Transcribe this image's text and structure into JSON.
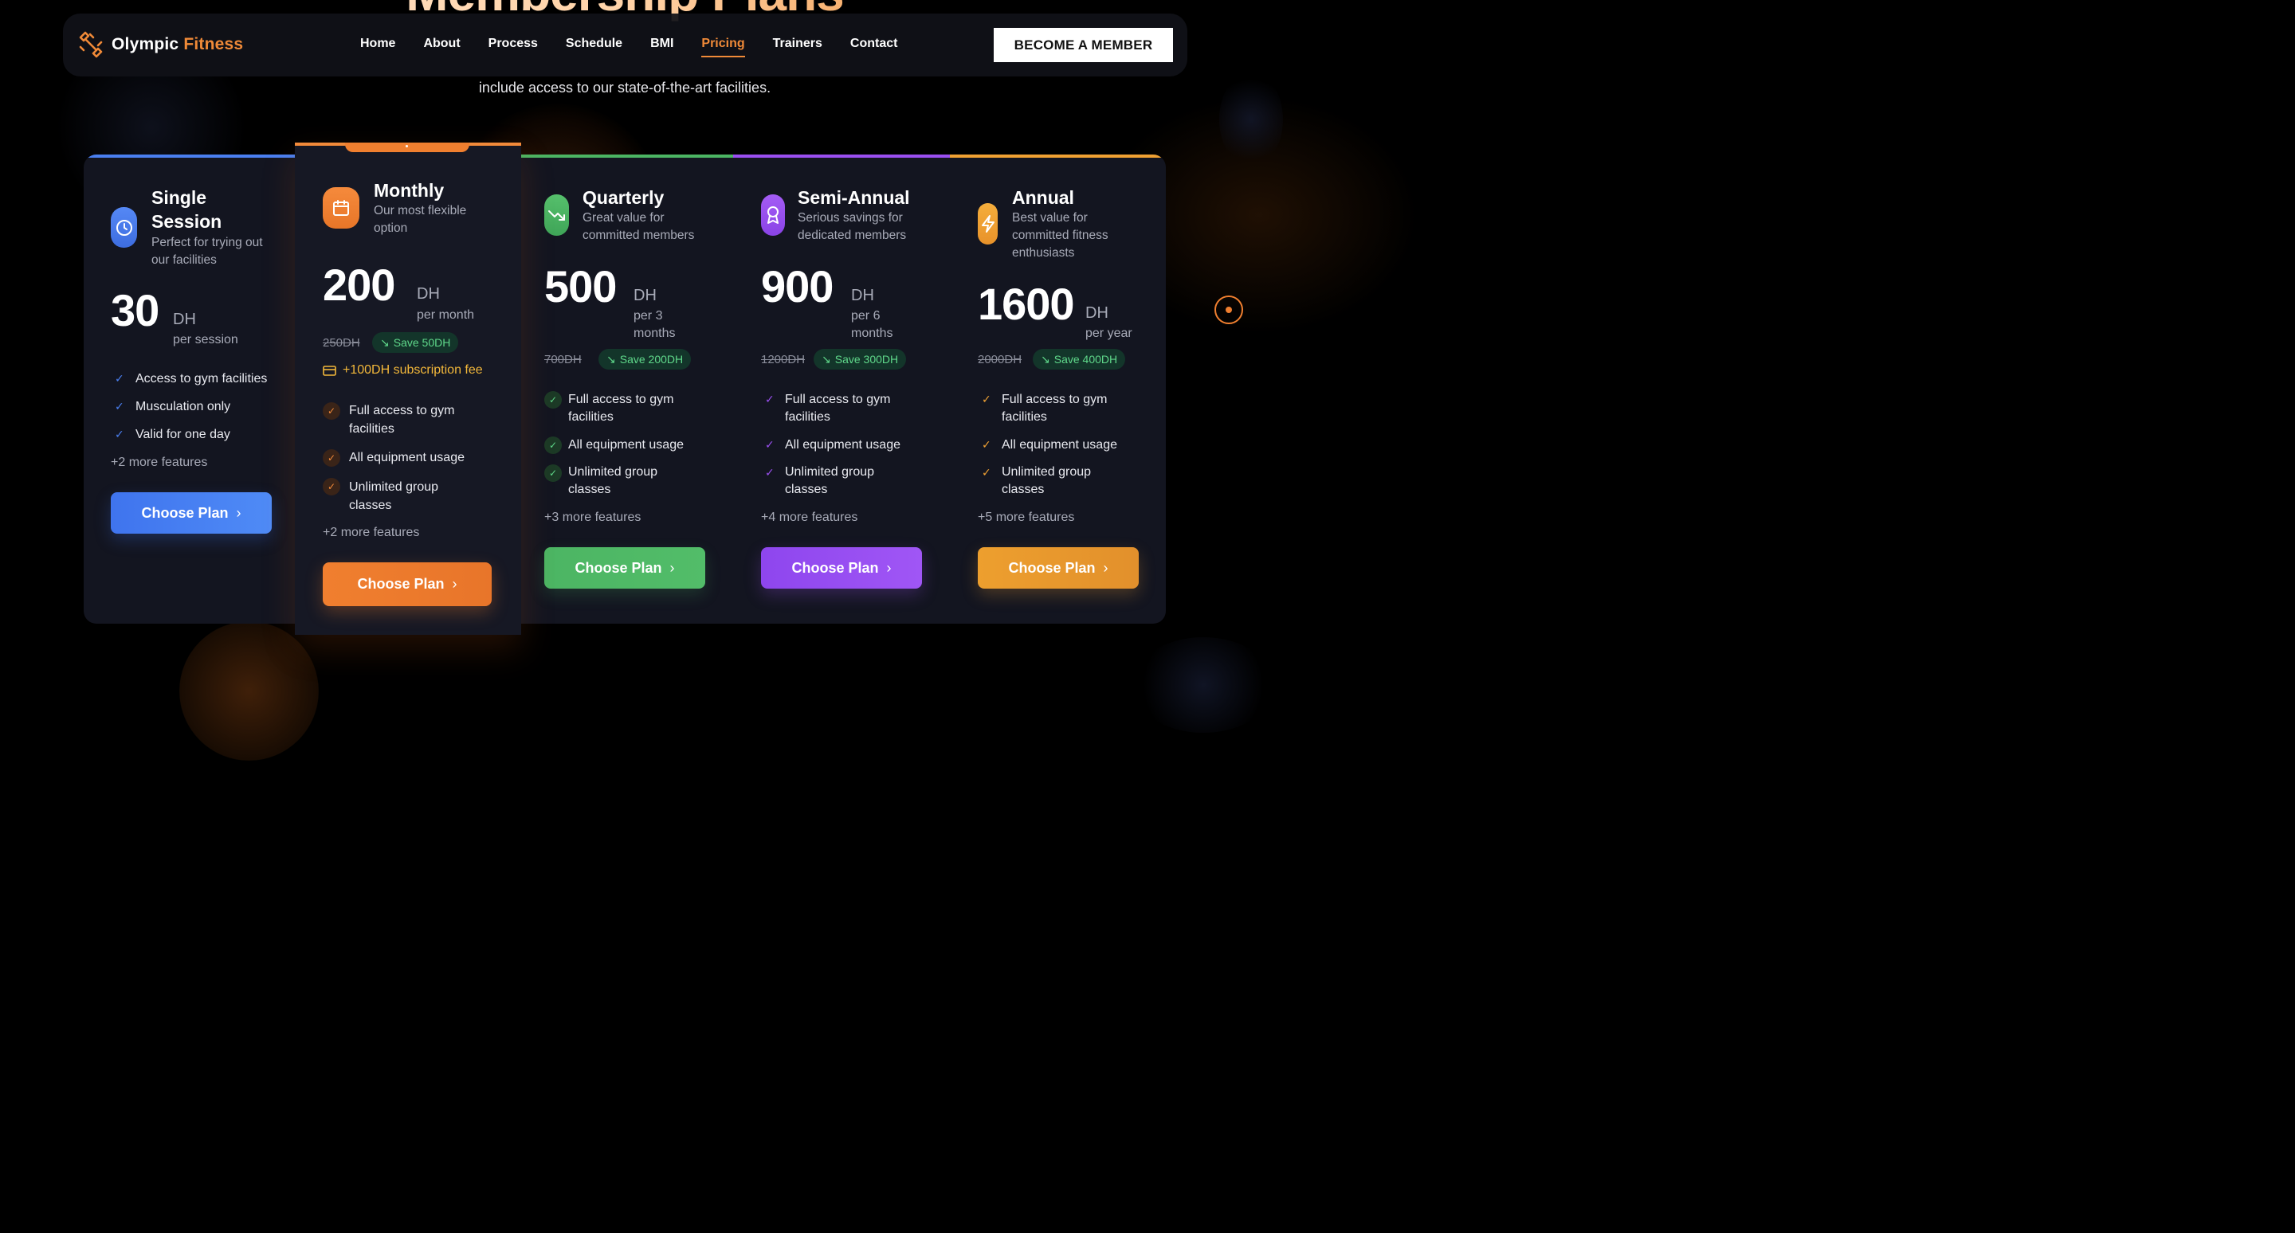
{
  "page": {
    "title": "Membership Plans",
    "subtitle": "include access to our state-of-the-art facilities."
  },
  "navbar": {
    "brand": {
      "part1": "Olympic",
      "part2": "Fitness",
      "icon": "dumbbell-icon"
    },
    "links": [
      {
        "label": "Home",
        "active": false
      },
      {
        "label": "About",
        "active": false
      },
      {
        "label": "Process",
        "active": false
      },
      {
        "label": "Schedule",
        "active": false
      },
      {
        "label": "BMI",
        "active": false
      },
      {
        "label": "Pricing",
        "active": true
      },
      {
        "label": "Trainers",
        "active": false
      },
      {
        "label": "Contact",
        "active": false
      }
    ],
    "cta": "BECOME A MEMBER"
  },
  "plans": [
    {
      "name_line1": "Single",
      "name_line2": "Session",
      "desc_line1": "Perfect for trying out",
      "desc_line2": "our facilities",
      "icon": "clock-icon",
      "color": "#4a7ff0",
      "price": "30",
      "currency": "DH",
      "period_line1": "per session",
      "features": [
        "Access to gym facilities",
        "Musculation only",
        "Valid for one day"
      ],
      "more": "+2 more features",
      "button": "Choose Plan"
    },
    {
      "name_line1": "Monthly",
      "desc_line1": "Our most flexible",
      "desc_line2": "option",
      "icon": "calendar-icon",
      "color": "#f07f2f",
      "price": "200",
      "currency": "DH",
      "period_line1": "per month",
      "old_price": "250DH",
      "save": "Save 50DH",
      "fee": "+100DH subscription fee",
      "features": [
        {
          "line1": "Full access to gym",
          "line2": "facilities"
        },
        {
          "line1": "All equipment usage"
        },
        {
          "line1": "Unlimited group",
          "line2": "classes"
        }
      ],
      "more": "+2 more features",
      "button": "Choose Plan"
    },
    {
      "name_line1": "Quarterly",
      "desc_line1": "Great value for",
      "desc_line2": "committed members",
      "icon": "trending-down-icon",
      "color": "#4cb563",
      "price": "500",
      "currency": "DH",
      "period_line1": "per 3",
      "period_line2": "months",
      "old_price": "700DH",
      "save": "Save 200DH",
      "features": [
        {
          "line1": "Full access to gym",
          "line2": "facilities"
        },
        {
          "line1": "All equipment usage"
        },
        {
          "line1": "Unlimited group",
          "line2": "classes"
        }
      ],
      "more": "+3 more features",
      "button": "Choose Plan"
    },
    {
      "name_line1": "Semi-Annual",
      "desc_line1": "Serious savings for",
      "desc_line2": "dedicated members",
      "icon": "award-icon",
      "color": "#9a4ff0",
      "price": "900",
      "currency": "DH",
      "period_line1": "per 6",
      "period_line2": "months",
      "old_price": "1200DH",
      "save": "Save 300DH",
      "features": [
        {
          "line1": "Full access to gym",
          "line2": "facilities"
        },
        {
          "line1": "All equipment usage"
        },
        {
          "line1": "Unlimited group",
          "line2": "classes"
        }
      ],
      "more": "+4 more features",
      "button": "Choose Plan"
    },
    {
      "name_line1": "Annual",
      "desc_line1": "Best value for",
      "desc_line2": "committed fitness",
      "desc_line3": "enthusiasts",
      "icon": "lightning-icon",
      "color": "#f0a133",
      "price": "1600",
      "currency": "DH",
      "period_line1": "per year",
      "old_price": "2000DH",
      "save": "Save 400DH",
      "features": [
        {
          "line1": "Full access to gym",
          "line2": "facilities"
        },
        {
          "line1": "All equipment usage"
        },
        {
          "line1": "Unlimited group",
          "line2": "classes"
        }
      ],
      "more": "+5 more features",
      "button": "Choose Plan"
    }
  ]
}
